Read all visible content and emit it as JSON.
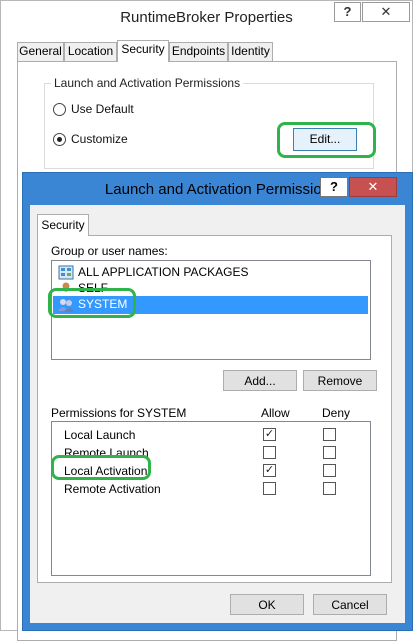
{
  "outer": {
    "title": "RuntimeBroker Properties",
    "help_glyph": "?",
    "close_glyph": "✕",
    "tabs": [
      {
        "label": "General"
      },
      {
        "label": "Location"
      },
      {
        "label": "Security"
      },
      {
        "label": "Endpoints"
      },
      {
        "label": "Identity"
      }
    ],
    "launch_group": {
      "legend": "Launch and Activation Permissions",
      "use_default_label": "Use Default",
      "customize_label": "Customize",
      "edit_label": "Edit..."
    }
  },
  "dialog": {
    "title": "Launch and Activation Permission",
    "help_glyph": "?",
    "close_glyph": "✕",
    "tab_label": "Security",
    "group_label": "Group or user names:",
    "users": [
      {
        "name": "ALL APPLICATION PACKAGES",
        "icon": "app-packages-icon"
      },
      {
        "name": "SELF",
        "icon": "user-icon"
      },
      {
        "name": "SYSTEM",
        "icon": "users-group-icon"
      }
    ],
    "add_label": "Add...",
    "remove_label": "Remove",
    "permissions_label": "Permissions for SYSTEM",
    "allow_header": "Allow",
    "deny_header": "Deny",
    "permissions": [
      {
        "name": "Local Launch",
        "allow": true,
        "deny": false
      },
      {
        "name": "Remote Launch",
        "allow": false,
        "deny": false
      },
      {
        "name": "Local Activation",
        "allow": true,
        "deny": false
      },
      {
        "name": "Remote Activation",
        "allow": false,
        "deny": false
      }
    ],
    "ok_label": "OK",
    "cancel_label": "Cancel"
  },
  "colors": {
    "dialog_frame": "#3a86d4",
    "selection": "#3399ff",
    "highlight_ring": "#2fb34a",
    "close_button": "#c75050"
  }
}
